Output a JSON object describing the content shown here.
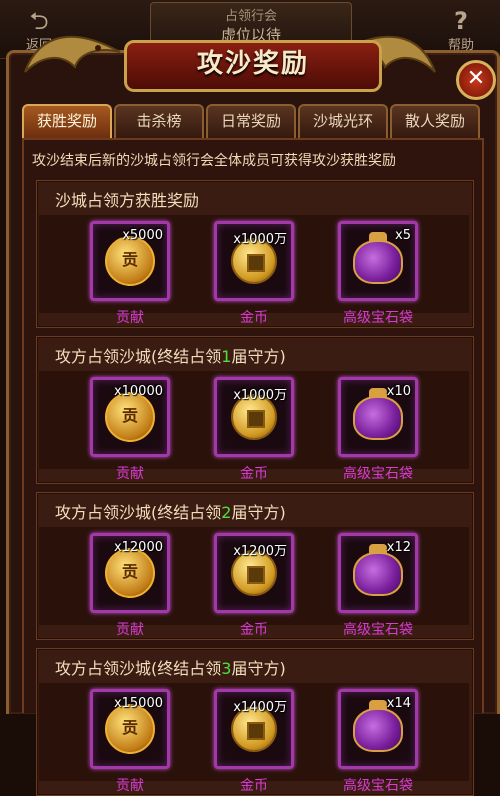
{
  "header": {
    "back_label": "返回",
    "back_icon": "back-arrow-icon",
    "help_label": "帮助",
    "guild_title": "占领行会",
    "guild_status": "虚位以待"
  },
  "panel": {
    "title": "攻沙奖励",
    "close_glyph": "✕"
  },
  "tabs": [
    {
      "label": "获胜奖励",
      "active": true
    },
    {
      "label": "击杀榜",
      "active": false
    },
    {
      "label": "日常奖励",
      "active": false
    },
    {
      "label": "沙城光环",
      "active": false
    },
    {
      "label": "散人奖励",
      "active": false
    }
  ],
  "intro": "攻沙结束后新的沙城占领行会全体成员可获得攻沙获胜奖励",
  "sections": [
    {
      "title_prefix": "沙城占领方获胜奖励",
      "title_number": "",
      "title_suffix": "",
      "items": [
        {
          "qty": "x5000",
          "name": "贡献",
          "icon": "contribution-medal-icon"
        },
        {
          "qty": "x1000万",
          "name": "金币",
          "icon": "gold-coin-icon"
        },
        {
          "qty": "x5",
          "name": "高级宝石袋",
          "icon": "gem-bag-icon"
        }
      ]
    },
    {
      "title_prefix": "攻方占领沙城(终结占领",
      "title_number": "1",
      "title_suffix": "届守方)",
      "items": [
        {
          "qty": "x10000",
          "name": "贡献",
          "icon": "contribution-medal-icon"
        },
        {
          "qty": "x1000万",
          "name": "金币",
          "icon": "gold-coin-icon"
        },
        {
          "qty": "x10",
          "name": "高级宝石袋",
          "icon": "gem-bag-icon"
        }
      ]
    },
    {
      "title_prefix": "攻方占领沙城(终结占领",
      "title_number": "2",
      "title_suffix": "届守方)",
      "items": [
        {
          "qty": "x12000",
          "name": "贡献",
          "icon": "contribution-medal-icon"
        },
        {
          "qty": "x1200万",
          "name": "金币",
          "icon": "gold-coin-icon"
        },
        {
          "qty": "x12",
          "name": "高级宝石袋",
          "icon": "gem-bag-icon"
        }
      ]
    },
    {
      "title_prefix": "攻方占领沙城(终结占领",
      "title_number": "3",
      "title_suffix": "届守方)",
      "items": [
        {
          "qty": "x15000",
          "name": "贡献",
          "icon": "contribution-medal-icon"
        },
        {
          "qty": "x1400万",
          "name": "金币",
          "icon": "gold-coin-icon"
        },
        {
          "qty": "x14",
          "name": "高级宝石袋",
          "icon": "gem-bag-icon"
        }
      ]
    }
  ],
  "colors": {
    "highlight_number": "#4fe040",
    "item_label": "#d83ad4",
    "slot_border": "#a13aa8"
  }
}
